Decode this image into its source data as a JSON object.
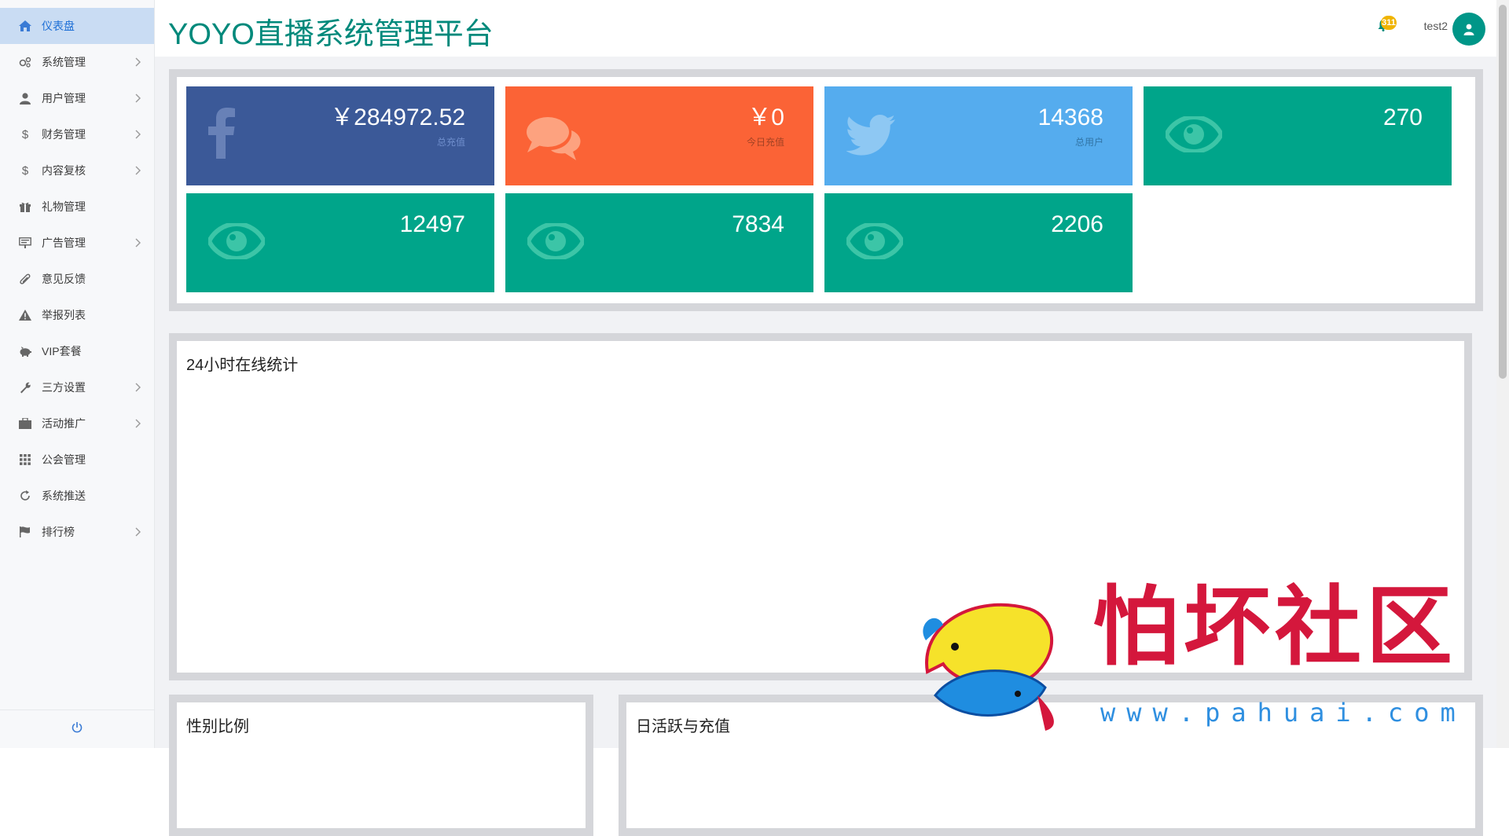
{
  "app": {
    "title": "YOYO直播系统管理平台"
  },
  "header": {
    "notification_count": "311",
    "username": "test2"
  },
  "sidebar": {
    "items": [
      {
        "label": "仪表盘",
        "icon": "home-icon",
        "active": true,
        "has_children": false
      },
      {
        "label": "系统管理",
        "icon": "gears-icon",
        "active": false,
        "has_children": true
      },
      {
        "label": "用户管理",
        "icon": "user-icon",
        "active": false,
        "has_children": true
      },
      {
        "label": "财务管理",
        "icon": "dollar-icon",
        "active": false,
        "has_children": true
      },
      {
        "label": "内容复核",
        "icon": "dollar-icon",
        "active": false,
        "has_children": true
      },
      {
        "label": "礼物管理",
        "icon": "gift-icon",
        "active": false,
        "has_children": false
      },
      {
        "label": "广告管理",
        "icon": "billboard-icon",
        "active": false,
        "has_children": true
      },
      {
        "label": "意见反馈",
        "icon": "paperclip-icon",
        "active": false,
        "has_children": false
      },
      {
        "label": "举报列表",
        "icon": "warning-icon",
        "active": false,
        "has_children": false
      },
      {
        "label": "VIP套餐",
        "icon": "piggy-bank-icon",
        "active": false,
        "has_children": false
      },
      {
        "label": "三方设置",
        "icon": "wrench-icon",
        "active": false,
        "has_children": true
      },
      {
        "label": "活动推广",
        "icon": "briefcase-icon",
        "active": false,
        "has_children": true
      },
      {
        "label": "公会管理",
        "icon": "grid-icon",
        "active": false,
        "has_children": false
      },
      {
        "label": "系统推送",
        "icon": "refresh-icon",
        "active": false,
        "has_children": false
      },
      {
        "label": "排行榜",
        "icon": "flag-icon",
        "active": false,
        "has_children": true
      }
    ],
    "footer_icon": "power-icon"
  },
  "stats": [
    {
      "value": "￥284972.52",
      "label": "总充值",
      "icon": "facebook-icon",
      "color": "#3b5998"
    },
    {
      "value": "￥0",
      "label": "今日充值",
      "icon": "comments-icon",
      "color": "#fb6336"
    },
    {
      "value": "14368",
      "label": "总用户",
      "icon": "twitter-icon",
      "color": "#55acee"
    },
    {
      "value": "270",
      "label": "",
      "icon": "eye-icon",
      "color": "#00a58a"
    },
    {
      "value": "12497",
      "label": "",
      "icon": "eye-icon",
      "color": "#00a58a"
    },
    {
      "value": "7834",
      "label": "",
      "icon": "eye-icon",
      "color": "#00a58a"
    },
    {
      "value": "2206",
      "label": "",
      "icon": "eye-icon",
      "color": "#00a58a"
    }
  ],
  "panels": {
    "online": {
      "title": "24小时在线统计"
    },
    "gender": {
      "title": "性别比例"
    },
    "activity": {
      "title": "日活跃与充值"
    }
  },
  "watermark": {
    "text": "怕坏社区",
    "url": "www.pahuai.com"
  },
  "colors": {
    "brand": "#00897b",
    "active_bg": "#c9dcf3",
    "active_text": "#1d6fd6",
    "badge": "#f0b400"
  }
}
